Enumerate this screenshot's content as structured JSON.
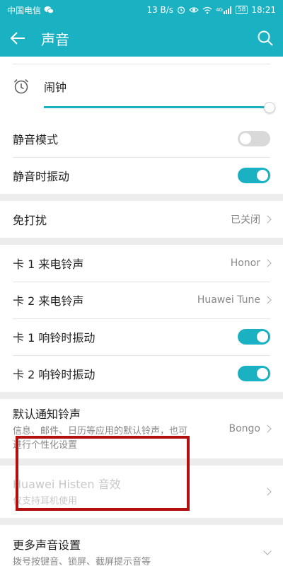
{
  "status_bar": {
    "carrier": "中国电信",
    "speed": "13 B/s",
    "battery": "58",
    "time": "18:21",
    "network": "4G"
  },
  "app_bar": {
    "title": "声音"
  },
  "alarm": {
    "label": "闹钟",
    "volume_fraction": 0.99
  },
  "silent_mode": {
    "label": "静音模式",
    "on": false
  },
  "vibrate_silent": {
    "label": "静音时振动",
    "on": true
  },
  "dnd": {
    "label": "免打扰",
    "value": "已关闭"
  },
  "sim1_ringtone": {
    "label": "卡 1 来电铃声",
    "value": "Honor"
  },
  "sim2_ringtone": {
    "label": "卡 2 来电铃声",
    "value": "Huawei Tune"
  },
  "sim1_vibrate": {
    "label": "卡 1 响铃时振动",
    "on": true
  },
  "sim2_vibrate": {
    "label": "卡 2 响铃时振动",
    "on": true
  },
  "notification_tone": {
    "label": "默认通知铃声",
    "desc": "信息、邮件、日历等应用的默认铃声，也可进行个性化设置",
    "value": "Bongo"
  },
  "histen": {
    "label": "Huawei Histen 音效",
    "desc": "仅支持耳机使用"
  },
  "more_sound": {
    "label": "更多声音设置",
    "desc": "拨号按键音、锁屏、截屏提示音等"
  },
  "colors": {
    "accent": "#1ab1c2",
    "highlight": "#b30f0f"
  }
}
